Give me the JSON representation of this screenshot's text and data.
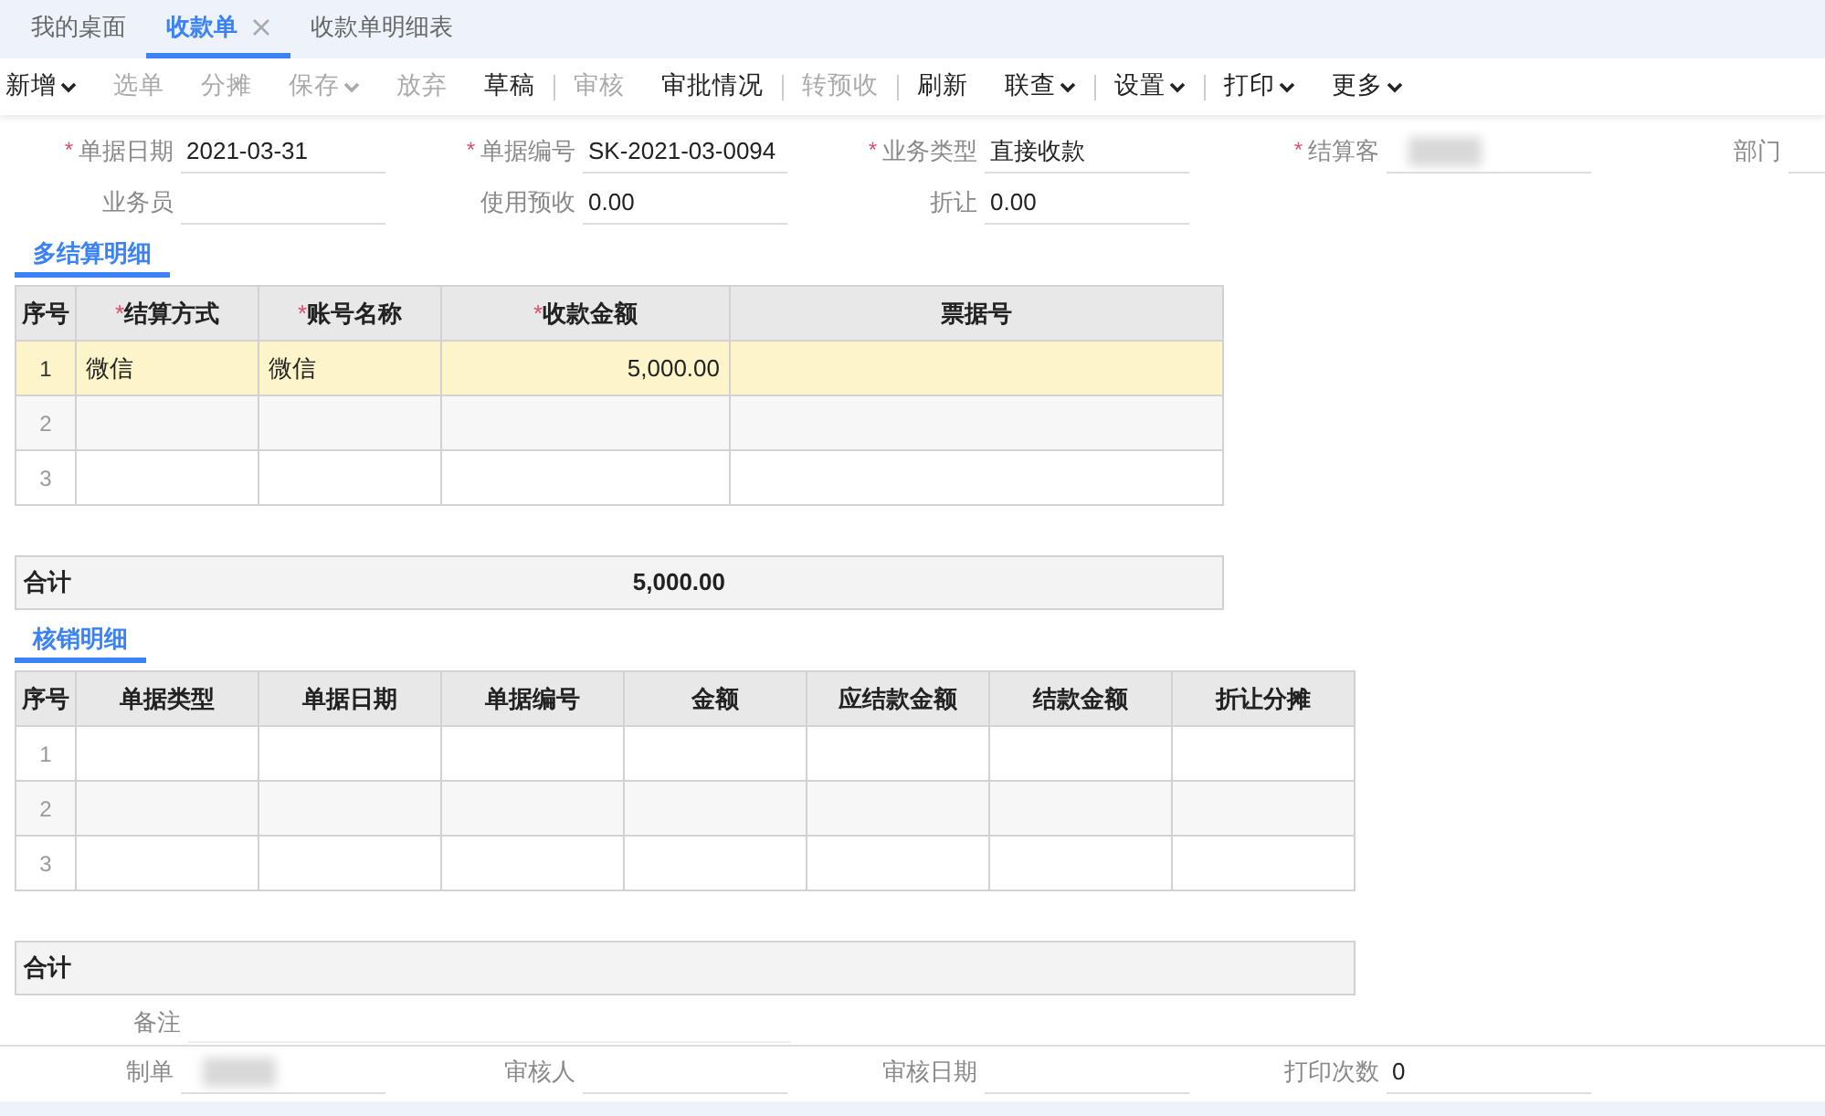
{
  "tabs": [
    {
      "label": "我的桌面",
      "selected": false,
      "closable": false
    },
    {
      "label": "收款单",
      "selected": true,
      "closable": true
    },
    {
      "label": "收款单明细表",
      "selected": false,
      "closable": false
    }
  ],
  "toolbar": [
    {
      "label": "新增",
      "disabled": false,
      "dropdown": true,
      "divider_before": false
    },
    {
      "label": "选单",
      "disabled": true,
      "dropdown": false,
      "divider_before": false
    },
    {
      "label": "分摊",
      "disabled": true,
      "dropdown": false,
      "divider_before": false
    },
    {
      "label": "保存",
      "disabled": true,
      "dropdown": true,
      "divider_before": false
    },
    {
      "label": "放弃",
      "disabled": true,
      "dropdown": false,
      "divider_before": false
    },
    {
      "label": "草稿",
      "disabled": false,
      "dropdown": false,
      "divider_before": false
    },
    {
      "label": "审核",
      "disabled": true,
      "dropdown": false,
      "divider_before": true
    },
    {
      "label": "审批情况",
      "disabled": false,
      "dropdown": false,
      "divider_before": false
    },
    {
      "label": "转预收",
      "disabled": true,
      "dropdown": false,
      "divider_before": true
    },
    {
      "label": "刷新",
      "disabled": false,
      "dropdown": false,
      "divider_before": true
    },
    {
      "label": "联查",
      "disabled": false,
      "dropdown": true,
      "divider_before": false
    },
    {
      "label": "设置",
      "disabled": false,
      "dropdown": true,
      "divider_before": true
    },
    {
      "label": "打印",
      "disabled": false,
      "dropdown": true,
      "divider_before": true
    },
    {
      "label": "更多",
      "disabled": false,
      "dropdown": true,
      "divider_before": false
    }
  ],
  "header_form": [
    [
      {
        "required_mark": "*",
        "label": "单据日期",
        "value": "2021-03-31"
      },
      {
        "required_mark": "*",
        "label": "单据编号",
        "value": "SK-2021-03-0094"
      },
      {
        "required_mark": "*",
        "label": "业务类型",
        "value": "直接收款"
      },
      {
        "required_mark": "*",
        "label": "结算客",
        "redacted": true
      },
      {
        "label": "部门"
      }
    ],
    [
      {
        "label": "业务员"
      },
      {
        "label": "使用预收",
        "value": "0.00"
      },
      {
        "label": "折让",
        "value": "0.00"
      }
    ]
  ],
  "sections": [
    {
      "title": "多结算明细",
      "columns": [
        {
          "label": "序号"
        },
        {
          "required_mark": "*",
          "label": "结算方式"
        },
        {
          "required_mark": "*",
          "label": "账号名称"
        },
        {
          "required_mark": "*",
          "label": "收款金额"
        },
        {
          "label": "票据号"
        }
      ],
      "rows": [
        {
          "selected": true,
          "cells": [
            "1",
            "微信",
            "微信",
            "5,000.00",
            ""
          ]
        },
        {
          "selected": false,
          "cells": [
            "2",
            "",
            "",
            "",
            ""
          ]
        },
        {
          "selected": false,
          "cells": [
            "3",
            "",
            "",
            "",
            ""
          ]
        }
      ],
      "total": {
        "label": "合计",
        "value": "5,000.00"
      }
    },
    {
      "title": "核销明细",
      "columns": [
        {
          "label": "序号"
        },
        {
          "label": "单据类型"
        },
        {
          "label": "单据日期"
        },
        {
          "label": "单据编号"
        },
        {
          "label": "金额"
        },
        {
          "label": "应结款金额"
        },
        {
          "label": "结款金额"
        },
        {
          "label": "折让分摊"
        }
      ],
      "rows": [
        {
          "selected": false,
          "cells": [
            "1",
            "",
            "",
            "",
            "",
            "",
            "",
            ""
          ]
        },
        {
          "selected": false,
          "cells": [
            "2",
            "",
            "",
            "",
            "",
            "",
            "",
            ""
          ]
        },
        {
          "selected": false,
          "cells": [
            "3",
            "",
            "",
            "",
            "",
            "",
            "",
            ""
          ]
        }
      ],
      "total": {
        "label": "合计"
      }
    }
  ],
  "remarks": {
    "label": "备注"
  },
  "footer_form": [
    {
      "label": "制单",
      "redacted": true
    },
    {
      "label": "审核人"
    },
    {
      "label": "审核日期"
    },
    {
      "label": "打印次数",
      "value": "0"
    }
  ]
}
